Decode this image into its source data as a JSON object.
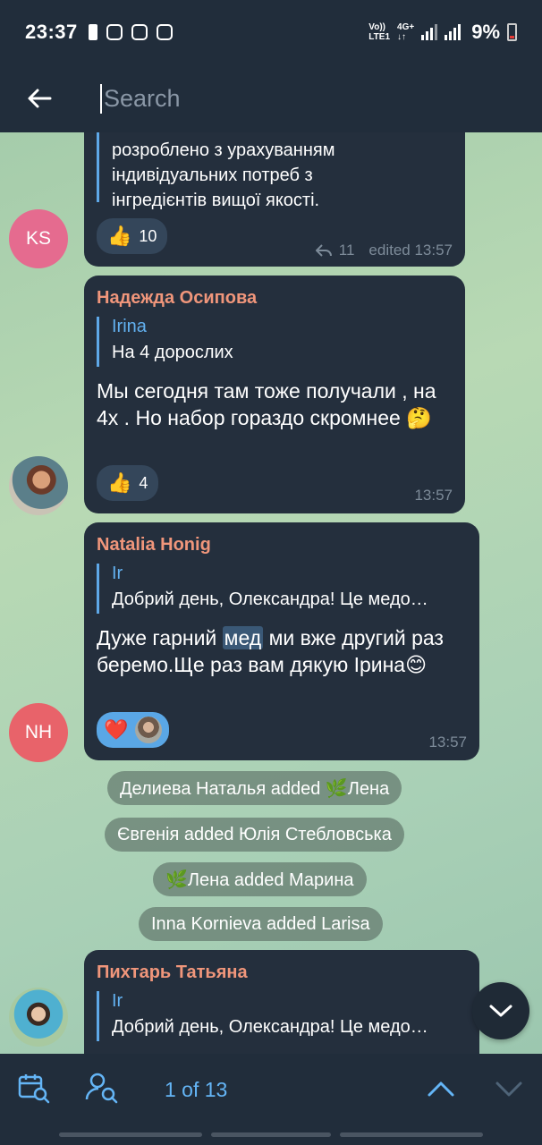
{
  "status_bar": {
    "time": "23:37",
    "network_top": "Vo))",
    "network_bottom": "LTE1",
    "net_type_top": "4G+",
    "net_type_bottom": "↓↑",
    "battery": "9%"
  },
  "search": {
    "placeholder": "Search",
    "value": ""
  },
  "messages": [
    {
      "text_lines": [
        "розроблено з урахуванням",
        "індивідуальних потреб з",
        "інгредієнтів вищої якості."
      ],
      "reaction_emoji": "👍",
      "reaction_count": "10",
      "replies": "11",
      "edited_time": "edited 13:57",
      "avatar_initials": "KS",
      "avatar_color": "#e56b8f"
    },
    {
      "sender": "Надежда Осипова",
      "reply_name": "Irina",
      "reply_text": "На 4 дорослих",
      "text": "Мы сегодня там тоже получали , на 4х . Но набор гораздо скромнее 🤔",
      "reaction_emoji": "👍",
      "reaction_count": "4",
      "time": "13:57"
    },
    {
      "sender": "Natalia Honig",
      "reply_name": "Ir",
      "reply_text": "Добрий день, Олександра! Це медо…",
      "text_before": "Дуже гарний ",
      "text_highlight": "мед",
      "text_after": " ми вже другий раз беремо.Ще раз вам дякую Ірина😊",
      "reaction_emoji": "❤️",
      "time": "13:57",
      "avatar_initials": "NH",
      "avatar_color": "#e8636a"
    },
    {
      "sender": "Пихтарь Татьяна",
      "reply_name": "Ir",
      "reply_text": "Добрий день, Олександра! Це медо…"
    }
  ],
  "service_messages": [
    "Делиева Наталья added 🌿Лена",
    "Євгенія added Юлія Стебловська",
    "🌿Лена added Марина",
    "Inna Kornieva added Larisa"
  ],
  "bottom": {
    "counter": "1 of 13"
  }
}
